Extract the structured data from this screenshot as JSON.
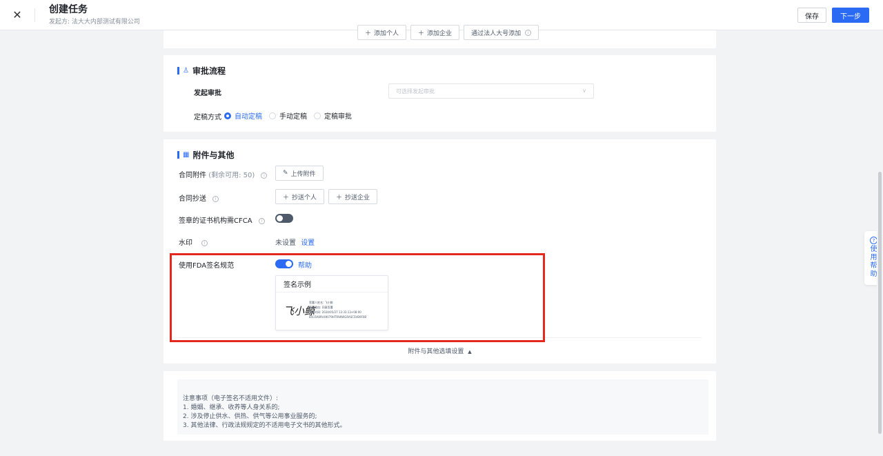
{
  "header": {
    "title": "创建任务",
    "subtitle": "发起方: 法大大内部测试有限公司",
    "save_label": "保存",
    "next_label": "下一步"
  },
  "participants": {
    "add_person": "添加个人",
    "add_company": "添加企业",
    "add_by_role": "通过法人大号添加"
  },
  "approval": {
    "title": "审批流程",
    "start_label": "发起审批",
    "start_placeholder": "可选择发起审批",
    "finalize_label": "定稿方式",
    "options": [
      "自动定稿",
      "手动定稿",
      "定稿审批"
    ],
    "selected": "自动定稿"
  },
  "attachments": {
    "title": "附件与其他",
    "attach_label": "合同附件",
    "attach_remaining": "(剩余可用: 50)",
    "upload_label": "上传附件",
    "cc_label": "合同抄送",
    "cc_person": "抄送个人",
    "cc_company": "抄送企业",
    "cfca_label": "签章的证书机构需CFCA",
    "watermark_label": "水印",
    "watermark_status": "未设置",
    "watermark_link": "设置",
    "fda_label": "使用FDA签名规范",
    "fda_help": "帮助",
    "sig_example_title": "签名示例",
    "sig_mark": "飞小鲸",
    "sig_meta": [
      "签署人姓名: 飞小鲸",
      "签署理由: 同意签署",
      "签署时间: 2024/05/27 13:33:13+08:00",
      "B5C6A89V49079HTRIWWGRASCSVB9F0B"
    ],
    "toggle_settings": "附件与其他选填设置"
  },
  "notes": {
    "title": "注意事项（电子签名不适用文件）:",
    "items": [
      "1. 婚姻、继承、收养等人身关系的;",
      "2. 涉及停止供水、供热、供气等公用事业服务的;",
      "3. 其他法律、行政法规规定的不适用电子文书的其他形式。"
    ]
  },
  "help_tab": {
    "label": "使用帮助"
  },
  "colors": {
    "accent": "#2b6bf3",
    "highlight": "#e5281d"
  },
  "toggles": {
    "cfca": false,
    "fda": true
  }
}
